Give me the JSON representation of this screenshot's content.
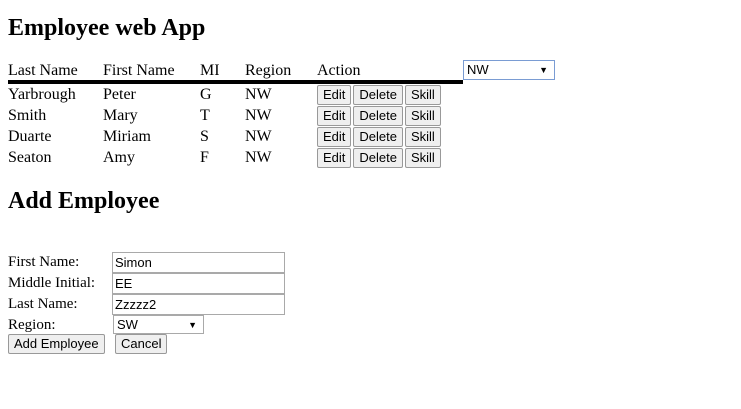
{
  "header": {
    "title": "Employee web App"
  },
  "employees_table": {
    "columns": [
      "Last Name",
      "First Name",
      "MI",
      "Region",
      "Action"
    ],
    "rows": [
      {
        "last": "Yarbrough",
        "first": "Peter",
        "mi": "G",
        "region": "NW"
      },
      {
        "last": "Smith",
        "first": "Mary",
        "mi": "T",
        "region": "NW"
      },
      {
        "last": "Duarte",
        "first": "Miriam",
        "mi": "S",
        "region": "NW"
      },
      {
        "last": "Seaton",
        "first": "Amy",
        "mi": "F",
        "region": "NW"
      }
    ],
    "actions": {
      "edit": "Edit",
      "delete": "Delete",
      "skill": "Skill"
    }
  },
  "region_filter": {
    "selected": "NW"
  },
  "add_form": {
    "title": "Add Employee",
    "labels": {
      "first": "First Name:",
      "middle": "Middle Initial:",
      "last": "Last Name:",
      "region": "Region:"
    },
    "values": {
      "first": "Simon",
      "middle": "EE",
      "last": "Zzzzz2",
      "region": "SW"
    },
    "add_button": "Add Employee",
    "cancel_button": "Cancel"
  },
  "icons": {
    "dropdown": "chevron-down-icon"
  }
}
